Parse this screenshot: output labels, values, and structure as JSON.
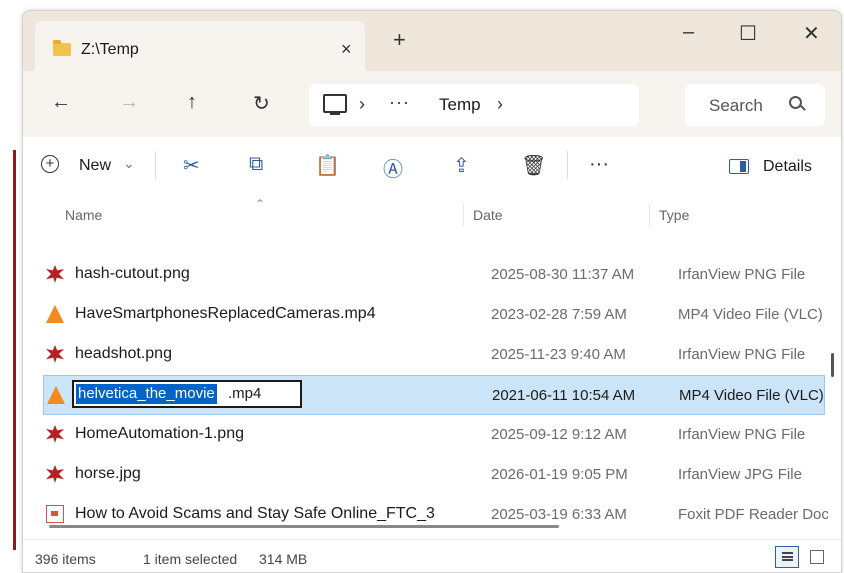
{
  "window": {
    "tab_title": "Z:\\Temp",
    "tab_close": "×",
    "new_tab": "+",
    "minimize": "–",
    "maximize": "☐",
    "close": "✕"
  },
  "nav": {
    "back": "←",
    "forward": "→",
    "up": "↑",
    "refresh": "↻",
    "sep1": "›",
    "more": "···",
    "folder": "Temp",
    "sep2": "›",
    "search_placeholder": "Search"
  },
  "toolbar": {
    "new_plus": "+",
    "new_label": "New",
    "new_caret": "⌄",
    "cut": "✂",
    "copy": "⧉",
    "paste": "📋",
    "rename": "Ⓐ",
    "share": "⇪",
    "delete": "🗑",
    "more": "···",
    "details_label": "Details"
  },
  "columns": {
    "name": "Name",
    "date": "Date",
    "type": "Type"
  },
  "files": [
    {
      "name": "hash-cutout.png",
      "date": "2025-08-30 11:37 AM",
      "type": "IrfanView PNG File",
      "icon": "irfanview-png-icon"
    },
    {
      "name": "HaveSmartphonesReplacedCameras.mp4",
      "date": "2023-02-28 7:59 AM",
      "type": "MP4 Video File (VLC)",
      "icon": "vlc-icon"
    },
    {
      "name": "headshot.png",
      "date": "2025-11-23 9:40 AM",
      "type": "IrfanView PNG File",
      "icon": "irfanview-png-icon"
    },
    {
      "name_selected": "helvetica_the_movie",
      "name_rest": ".mp4",
      "date": "2021-06-11 10:54 AM",
      "type": "MP4 Video File (VLC)",
      "icon": "vlc-icon",
      "renaming": true
    },
    {
      "name": "HomeAutomation-1.png",
      "date": "2025-09-12 9:12 AM",
      "type": "IrfanView PNG File",
      "icon": "irfanview-png-icon"
    },
    {
      "name": "horse.jpg",
      "date": "2026-01-19 9:05 PM",
      "type": "IrfanView JPG File",
      "icon": "irfanview-jpg-icon"
    },
    {
      "name": "How to Avoid Scams and Stay Safe Online_FTC_3",
      "date": "2025-03-19 6:33 AM",
      "type": "Foxit PDF Reader Doc",
      "icon": "pdf-icon"
    }
  ],
  "status": {
    "items": "396 items",
    "selected": "1 item selected",
    "size": "314 MB"
  },
  "colors": {
    "selection": "#cce4f7",
    "accent": "#2a5fa8",
    "titlebar": "#efe7db"
  }
}
